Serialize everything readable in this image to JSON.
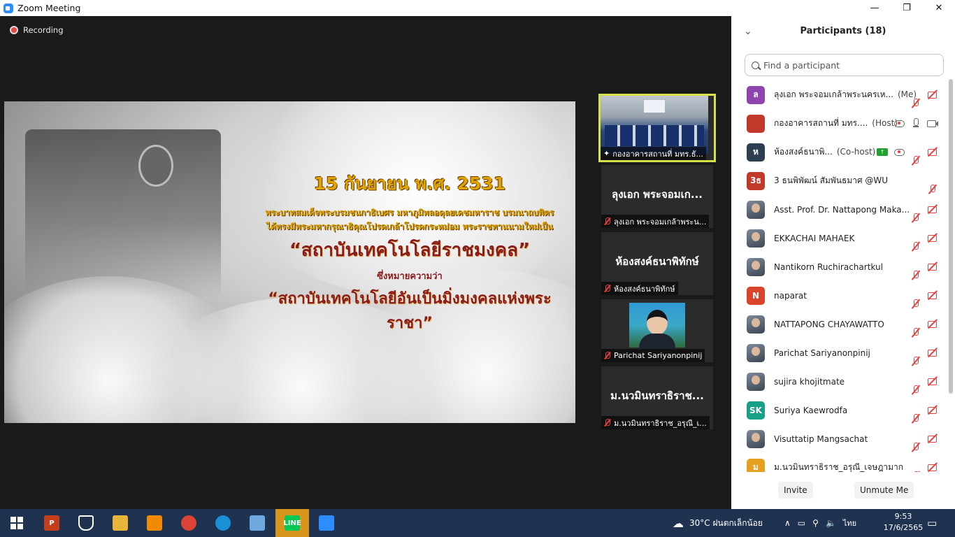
{
  "window": {
    "title": "Zoom Meeting",
    "controls": [
      "—",
      "❐",
      "✕"
    ]
  },
  "meeting": {
    "recording_label": "Recording",
    "slide": {
      "date": "15 กันยายน พ.ศ. 2531",
      "line1": "พระบาทสมเด็จพระบรมชนกาธิเบศร มหาภูมิพลอดุลยเดชมหาราช บรมนาถบพิตร",
      "line2": "ได้ทรงมีพระมหากรุณาธิคุณโปรดเกล้าโปรดกระหม่อม พระราชทานนามใหม่เป็น",
      "name1": "“สถาบันเทคโนโลยีราชมงคล”",
      "meaning": "ซึ่งหมายความว่า",
      "name2": "“สถาบันเทคโนโลยีอันเป็นมิ่งมงคลแห่งพระราชา”"
    },
    "thumbnails": [
      {
        "label": "กองอาคารสถานที่ มทร.ธั...",
        "kind": "video-hall",
        "active": true
      },
      {
        "big_name": "ลุงเอก พระจอมเก...",
        "label": "ลุงเอก พระจอมเกล้าพระน...",
        "kind": "name"
      },
      {
        "big_name": "ห้องสงค์ธนาพิทักษ์",
        "label": "ห้องสงค์ธนาพิทักษ์",
        "kind": "name"
      },
      {
        "label": "Parichat Sariyanonpinij",
        "kind": "photo"
      },
      {
        "big_name": "ม.นวมินทราธิราช...",
        "label": "ม.นวมินทราธิราช_อรุณี_เ...",
        "kind": "name"
      }
    ]
  },
  "participants": {
    "title": "Participants (18)",
    "search_placeholder": "Find a participant",
    "items": [
      {
        "avatar": "ล",
        "avatar_color": "#8e44ad",
        "name": "ลุงเอก พระจอมเกล้าพระนครเห...",
        "role": "(Me)",
        "icons": [
          "mic-red",
          "cam-red"
        ]
      },
      {
        "avatar": "",
        "avatar_color": "#c0392b",
        "name": "กองอาคารสถานที่ มทร....",
        "role": "(Host)",
        "icons": [
          "rec-cloud",
          "mic-gray",
          "cam-gray"
        ]
      },
      {
        "avatar": "ห",
        "avatar_color": "#2c3e50",
        "name": "ห้องสงค์ธนาพิ...",
        "role": "(Co-host)",
        "icons": [
          "share-badge",
          "rec-cloud",
          "mic-red",
          "cam-red"
        ]
      },
      {
        "avatar": "3ธ",
        "avatar_color": "#c0392b",
        "name": "3 ธนพิพัฒน์ สัมพันธมาศ @WU",
        "role": "",
        "icons": [
          "mic-red"
        ]
      },
      {
        "avatar": "",
        "avatar_color": "img",
        "name": "Asst. Prof. Dr. Nattapong Maka...",
        "role": "",
        "icons": [
          "mic-red",
          "cam-red"
        ]
      },
      {
        "avatar": "",
        "avatar_color": "img",
        "name": "EKKACHAI MAHAEK",
        "role": "",
        "icons": [
          "mic-red",
          "cam-red"
        ]
      },
      {
        "avatar": "",
        "avatar_color": "img",
        "name": "Nantikorn Ruchirachartkul",
        "role": "",
        "icons": [
          "mic-red",
          "cam-red"
        ]
      },
      {
        "avatar": "N",
        "avatar_color": "#d9442b",
        "name": "naparat",
        "role": "",
        "icons": [
          "mic-red",
          "cam-red"
        ]
      },
      {
        "avatar": "",
        "avatar_color": "img",
        "name": "NATTAPONG CHAYAWATTO",
        "role": "",
        "icons": [
          "mic-red",
          "cam-red"
        ]
      },
      {
        "avatar": "",
        "avatar_color": "img",
        "name": "Parichat Sariyanonpinij",
        "role": "",
        "icons": [
          "mic-red",
          "cam-red"
        ]
      },
      {
        "avatar": "",
        "avatar_color": "img",
        "name": "sujira khojitmate",
        "role": "",
        "icons": [
          "mic-red",
          "cam-red"
        ]
      },
      {
        "avatar": "SK",
        "avatar_color": "#16a085",
        "name": "Suriya  Kaewrodfa",
        "role": "",
        "icons": [
          "mic-red",
          "cam-red"
        ]
      },
      {
        "avatar": "",
        "avatar_color": "img",
        "name": "Visuttatip Mangsachat",
        "role": "",
        "icons": [
          "mic-red",
          "cam-red"
        ]
      },
      {
        "avatar": "ม",
        "avatar_color": "#e6a020",
        "name": "ม.นวมินทราธิราช_อรุณี_เจษฎามาก",
        "role": "",
        "icons": [
          "mic-red",
          "cam-red"
        ]
      }
    ],
    "invite_label": "Invite",
    "unmute_label": "Unmute Me"
  },
  "taskbar": {
    "apps": [
      {
        "name": "start",
        "label": ""
      },
      {
        "name": "powerpoint",
        "label": "P",
        "color": "#c43e1c"
      },
      {
        "name": "security",
        "label": "",
        "color": "#1f3350"
      },
      {
        "name": "file-explorer",
        "label": "",
        "color": "#e8b43a"
      },
      {
        "name": "vlc",
        "label": "",
        "color": "#f08a00"
      },
      {
        "name": "chrome",
        "label": "",
        "color": "#db4437"
      },
      {
        "name": "edge",
        "label": "",
        "color": "#1b8fd6"
      },
      {
        "name": "paint",
        "label": "",
        "color": "#6fa8dc"
      },
      {
        "name": "line",
        "label": "LINE",
        "color": "#06c755"
      },
      {
        "name": "zoom",
        "label": "",
        "color": "#2d8cff"
      }
    ],
    "weather": "30°C  ฝนตกเล็กน้อย",
    "language": "ไทย",
    "time": "9:53",
    "date": "17/6/2565"
  }
}
